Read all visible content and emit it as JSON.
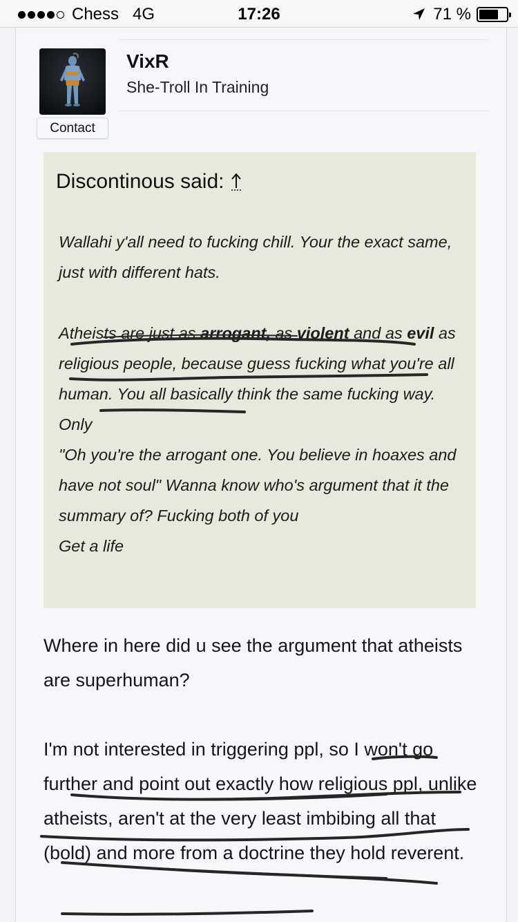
{
  "status_bar": {
    "carrier": "Chess",
    "network": "4G",
    "time": "17:26",
    "battery_text": "71 %",
    "battery_level": 0.71,
    "signal_bars": 4,
    "icons": [
      "signal-dots",
      "location-arrow-icon",
      "battery-icon"
    ]
  },
  "author": {
    "username": "VixR",
    "title": "She-Troll In Training",
    "contact_label": "Contact"
  },
  "quote": {
    "header": "Discontinous said:",
    "icon": "up-arrow-icon",
    "para1": "Wallahi y'all need to fucking chill. Your the exact same, just with different hats.",
    "p2_a": "Atheists are just as ",
    "p2_b": "arrogant,",
    "p2_c": " as ",
    "p2_d": "violent",
    "p2_e": " and as ",
    "p2_f": "evil",
    "p2_g": " as religious people, because guess fucking what you're all human. You all basically think the same fucking way. Only",
    "line3": "\"Oh you're the arrogant one. You believe in hoaxes and have not soul\" Wanna know who's argument that it the summary of? Fucking both of you",
    "line4": "Get a life"
  },
  "reply": {
    "para1": "Where in here did u see the argument that atheists are superhuman?",
    "para2": "I'm not interested in triggering ppl, so I won't go further and point out exactly how religious ppl, unlike atheists, aren't at the very least imbibing all that (bold) and more from a doctrine they hold reverent."
  },
  "colors": {
    "page_bg": "#f2f3f8",
    "post_bg": "#f6f7fb",
    "quote_bg": "#e9e8dc",
    "ink": "#2a2a2a"
  }
}
